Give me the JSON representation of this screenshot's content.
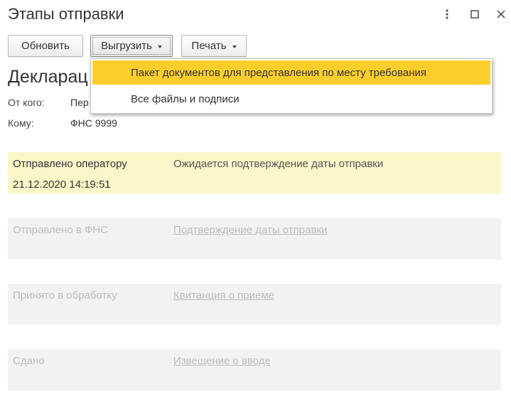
{
  "window": {
    "title": "Этапы отправки",
    "more_icon": "vertical-dots-icon",
    "maximize_icon": "maximize-icon",
    "close_icon": "close-icon"
  },
  "toolbar": {
    "refresh_label": "Обновить",
    "export_label": "Выгрузить",
    "print_label": "Печать"
  },
  "export_menu": {
    "items": [
      {
        "label": "Пакет документов для представления по месту требования",
        "highlighted": true
      },
      {
        "label": "Все файлы и подписи",
        "highlighted": false
      }
    ]
  },
  "document": {
    "title": "Декларац",
    "from_label": "От кого:",
    "from_value": "Пер",
    "to_label": "Кому:",
    "to_value": "ФНС 9999"
  },
  "stages": [
    {
      "label": "Отправлено оператору",
      "status": "Ожидается подтверждение даты отправки",
      "date": "21.12.2020 14:19:51",
      "active": true
    },
    {
      "label": "Отправлено в ФНС",
      "link": "Подтверждение даты отправки",
      "active": false
    },
    {
      "label": "Принято в обработку",
      "link": "Квитанция о приеме",
      "active": false
    },
    {
      "label": "Сдано",
      "link": "Извещение о вводе",
      "active": false
    }
  ],
  "colors": {
    "active_stage_bg": "#fdf6c8",
    "menu_highlight": "#fcce2c",
    "inactive_stage_bg": "#f2f2f2"
  }
}
